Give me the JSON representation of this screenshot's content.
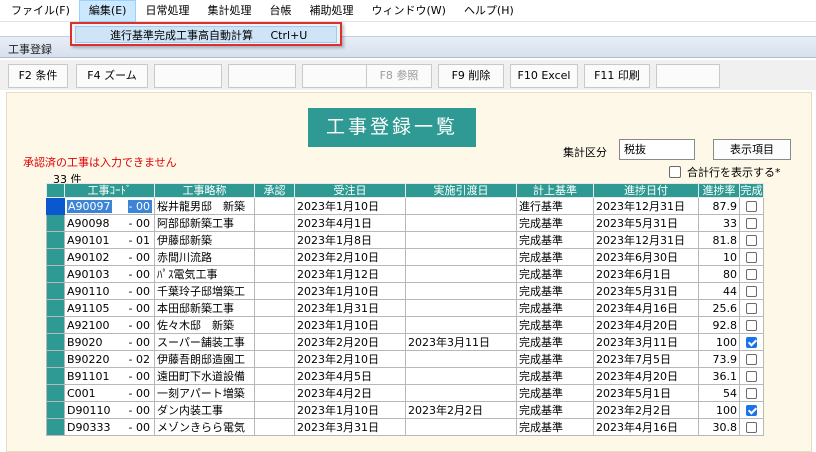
{
  "menubar": {
    "items": [
      {
        "label": "ファイル(F)"
      },
      {
        "label": "編集(E)"
      },
      {
        "label": "日常処理"
      },
      {
        "label": "集計処理"
      },
      {
        "label": "台帳"
      },
      {
        "label": "補助処理"
      },
      {
        "label": "ウィンドウ(W)"
      },
      {
        "label": "ヘルプ(H)"
      }
    ]
  },
  "dropdown": {
    "item_label": "進行基準完成工事高自動計算",
    "item_shortcut": "Ctrl+U"
  },
  "window": {
    "title": "工事登録"
  },
  "toolbar": {
    "f2": "F2 条件",
    "f4": "F4 ズーム",
    "f8": "F8 参照",
    "f9": "F9 削除",
    "f10": "F10 Excel",
    "f11": "F11 印刷"
  },
  "main": {
    "heading": "工事登録一覧",
    "warning": "承認済の工事は入力できません",
    "count": "33 件",
    "aggregate_label": "集計区分",
    "aggregate_value": "税抜",
    "display_button": "表示項目",
    "show_total_label": "合計行を表示する*"
  },
  "table": {
    "headers": [
      "工事ｺｰﾄﾞ",
      "工事略称",
      "承認",
      "受注日",
      "実施引渡日",
      "計上基準",
      "進捗日付",
      "進捗率",
      "完成"
    ],
    "rows": [
      {
        "code": "A90097",
        "sub": "- 00",
        "name": "桜井龍男邸　新築",
        "approval": "",
        "order_date": "2023年1月10日",
        "delivery_date": "",
        "basis": "進行基準",
        "progress_date": "2023年12月31日",
        "rate": "87.9",
        "complete": false
      },
      {
        "code": "A90098",
        "sub": "- 00",
        "name": "阿部邸新築工事",
        "approval": "",
        "order_date": "2023年4月1日",
        "delivery_date": "",
        "basis": "完成基準",
        "progress_date": "2023年5月31日",
        "rate": "33",
        "complete": false
      },
      {
        "code": "A90101",
        "sub": "- 01",
        "name": "伊藤邸新築",
        "approval": "",
        "order_date": "2023年1月8日",
        "delivery_date": "",
        "basis": "完成基準",
        "progress_date": "2023年12月31日",
        "rate": "81.8",
        "complete": false
      },
      {
        "code": "A90102",
        "sub": "- 00",
        "name": "赤間川流路",
        "approval": "",
        "order_date": "2023年2月10日",
        "delivery_date": "",
        "basis": "完成基準",
        "progress_date": "2023年6月30日",
        "rate": "10",
        "complete": false
      },
      {
        "code": "A90103",
        "sub": "- 00",
        "name": "ﾊﾟｽ電気工事",
        "approval": "",
        "order_date": "2023年1月12日",
        "delivery_date": "",
        "basis": "完成基準",
        "progress_date": "2023年6月1日",
        "rate": "80",
        "complete": false
      },
      {
        "code": "A90110",
        "sub": "- 00",
        "name": "千葉玲子邸増築工",
        "approval": "",
        "order_date": "2023年1月10日",
        "delivery_date": "",
        "basis": "完成基準",
        "progress_date": "2023年5月31日",
        "rate": "44",
        "complete": false
      },
      {
        "code": "A91105",
        "sub": "- 00",
        "name": "本田邸新築工事",
        "approval": "",
        "order_date": "2023年1月31日",
        "delivery_date": "",
        "basis": "完成基準",
        "progress_date": "2023年4月16日",
        "rate": "25.6",
        "complete": false
      },
      {
        "code": "A92100",
        "sub": "- 00",
        "name": "佐々木邸　新築",
        "approval": "",
        "order_date": "2023年1月10日",
        "delivery_date": "",
        "basis": "完成基準",
        "progress_date": "2023年4月20日",
        "rate": "92.8",
        "complete": false
      },
      {
        "code": "B9020",
        "sub": "- 00",
        "name": "スーパー舗装工事",
        "approval": "",
        "order_date": "2023年2月20日",
        "delivery_date": "2023年3月11日",
        "basis": "完成基準",
        "progress_date": "2023年3月11日",
        "rate": "100",
        "complete": true
      },
      {
        "code": "B90220",
        "sub": "- 02",
        "name": "伊藤吾朗邸造園工",
        "approval": "",
        "order_date": "2023年2月10日",
        "delivery_date": "",
        "basis": "完成基準",
        "progress_date": "2023年7月5日",
        "rate": "73.9",
        "complete": false
      },
      {
        "code": "B91101",
        "sub": "- 00",
        "name": "遠田町下水道設備",
        "approval": "",
        "order_date": "2023年4月5日",
        "delivery_date": "",
        "basis": "完成基準",
        "progress_date": "2023年4月20日",
        "rate": "36.1",
        "complete": false
      },
      {
        "code": "C001",
        "sub": "- 00",
        "name": "一刻アパート増築",
        "approval": "",
        "order_date": "2023年4月2日",
        "delivery_date": "",
        "basis": "完成基準",
        "progress_date": "2023年5月1日",
        "rate": "54",
        "complete": false
      },
      {
        "code": "D90110",
        "sub": "- 00",
        "name": "ダン内装工事",
        "approval": "",
        "order_date": "2023年1月10日",
        "delivery_date": "2023年2月2日",
        "basis": "完成基準",
        "progress_date": "2023年2月2日",
        "rate": "100",
        "complete": true
      },
      {
        "code": "D90333",
        "sub": "- 00",
        "name": "メゾンきらら電気",
        "approval": "",
        "order_date": "2023年3月31日",
        "delivery_date": "",
        "basis": "完成基準",
        "progress_date": "2023年4月16日",
        "rate": "30.8",
        "complete": false
      }
    ]
  }
}
